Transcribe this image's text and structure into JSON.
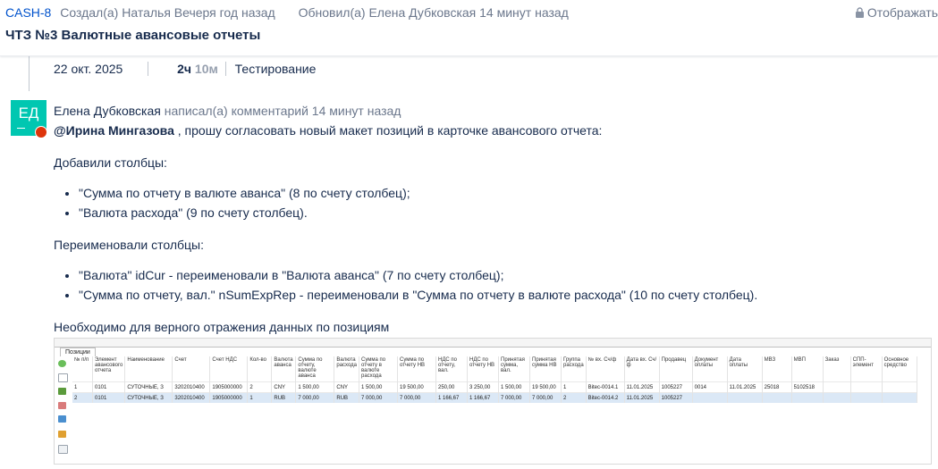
{
  "header": {
    "issue_key": "CASH-8",
    "created": "Создал(а) Наталья Вечеря год назад",
    "updated": "Обновил(а) Елена Дубковская 14 минут назад",
    "display": "Отображать",
    "title": "ЧТЗ №3 Валютные авансовые отчеты"
  },
  "worklog": {
    "date": "22 окт. 2025",
    "hours": "2ч",
    "minutes": "10м",
    "activity": "Тестирование"
  },
  "comment": {
    "avatar_initials": "ЕД",
    "author": "Елена Дубковская",
    "action": "написал(а) комментарий 14 минут назад",
    "mention": "@Ирина Мингазова",
    "intro": ", прошу согласовать новый макет позиций в карточке авансового отчета:",
    "added_title": "Добавили столбцы:",
    "added": [
      "\"Сумма по отчету в валюте аванса\" (8 по счету столбец);",
      "\"Валюта расхода\" (9 по счету столбец)."
    ],
    "renamed_title": "Переименовали столбцы:",
    "renamed": [
      "\"Валюта\" idCur - переименовали в \"Валюта аванса\" (7 по счету столбец);",
      "\"Сумма по отчету, вал.\" nSumExpRep - переименовали в \"Сумма по отчету в валюте расхода\" (10 по счету столбец)."
    ],
    "footer": "Необходимо для верного отражения данных по позициям"
  },
  "screenshot": {
    "tab": "Позиции",
    "columns": [
      "№ п/п",
      "Элемент авансового отчета",
      "Наименование",
      "Счет",
      "Счет НДС",
      "Кол-во",
      "Валюта аванса",
      "Сумма по отчету, валюте аванса",
      "Валюта расхода",
      "Сумма по отчету в валюте расхода",
      "Сумма по отчету НВ",
      "НДС по отчету, вал.",
      "НДС по отчету НВ",
      "Принятая сумма, вал.",
      "Принятая сумма НВ",
      "Группа расхода",
      "№ вх. Сч/ф",
      "Дата вх. Сч/ф",
      "Продавец",
      "Документ оплаты",
      "Дата оплаты",
      "МВЗ",
      "МВП",
      "Заказ",
      "СПП-элемент",
      "Основное средство"
    ],
    "rows": [
      [
        "1",
        "0101",
        "СУТОЧНЫЕ, З",
        "3202010400",
        "1905000000",
        "2",
        "CNY",
        "1 500,00",
        "CNY",
        "1 500,00",
        "19 500,00",
        "250,00",
        "3 250,00",
        "1 500,00",
        "19 500,00",
        "1",
        "Bitec-0014.1",
        "11.01.2025",
        "1005227",
        "0014",
        "11.01.2025",
        "25018",
        "5102518",
        "",
        "",
        ""
      ],
      [
        "2",
        "0101",
        "СУТОЧНЫЕ, З",
        "3202010400",
        "1905000000",
        "1",
        "RUB",
        "7 000,00",
        "RUB",
        "7 000,00",
        "7 000,00",
        "1 166,67",
        "1 166,67",
        "7 000,00",
        "7 000,00",
        "2",
        "Bitec-0014.2",
        "11.01.2025",
        "1005227",
        "",
        "",
        "",
        "",
        "",
        "",
        ""
      ]
    ]
  },
  "colors": {
    "accent": "#0052cc",
    "avatar": "#00c7b1",
    "badge": "#de350b"
  }
}
